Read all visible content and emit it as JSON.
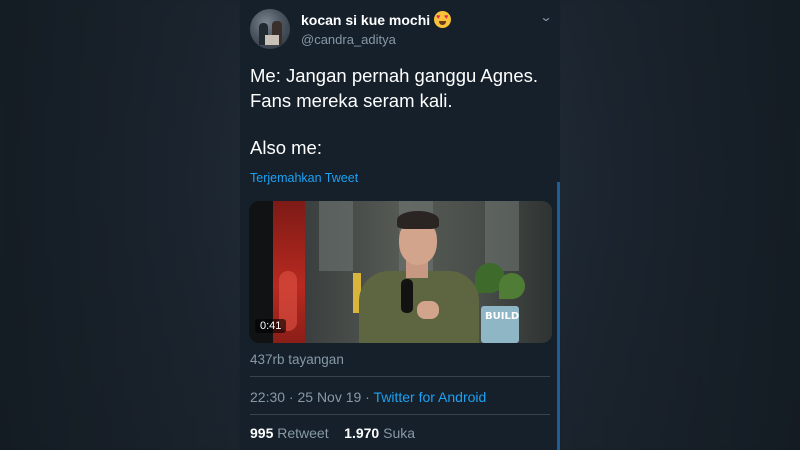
{
  "user": {
    "display_name": "kocan si kue mochi",
    "name_emoji": "smiling-face-with-heart-eyes",
    "handle": "@candra_aditya"
  },
  "tweet": {
    "lines": [
      "Me: Jangan pernah ganggu Agnes.",
      "Fans mereka seram kali."
    ],
    "also": "Also me:",
    "translate_link": "Terjemahkan Tweet"
  },
  "video": {
    "duration": "0:41",
    "overlay_text": "BUILD"
  },
  "views": "437rb tayangan",
  "meta": {
    "time_date": "22:30 · 25 Nov 19 · ",
    "client": "Twitter for Android"
  },
  "stats": {
    "retweets_count": "995",
    "retweets_label": "Retweet",
    "likes_count": "1.970",
    "likes_label": "Suka"
  },
  "colors": {
    "background": "#15202b",
    "accent": "#1da1f2",
    "secondary_text": "#8899a6"
  }
}
